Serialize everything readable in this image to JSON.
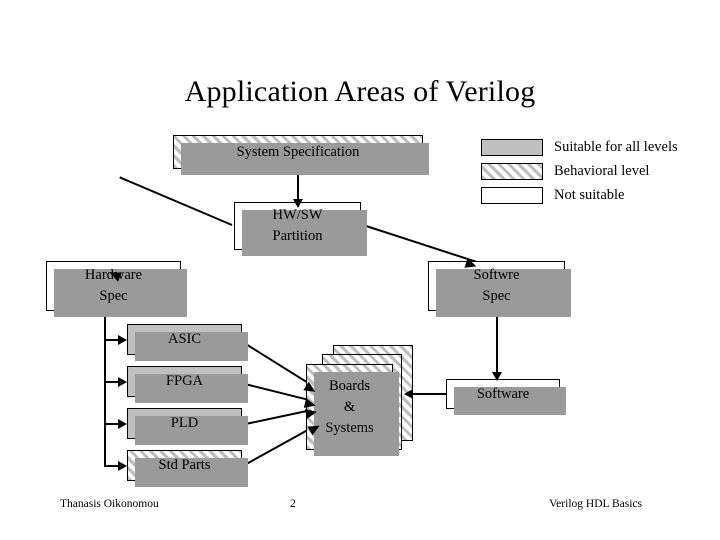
{
  "slide": {
    "title": "Application Areas of Verilog",
    "page_number": "2"
  },
  "legend": {
    "items": [
      {
        "swatch": "solid-gray-swatch",
        "label": "Suitable for all levels",
        "color": "#c0c0c0"
      },
      {
        "swatch": "hatched-swatch",
        "label": "Behavioral level",
        "color": "#bdbdbd"
      },
      {
        "swatch": "white-swatch",
        "label": "Not suitable",
        "color": "#ffffff"
      }
    ]
  },
  "diagram": {
    "nodes": {
      "system_specification": {
        "label": "System Specification",
        "fill": "Behavioral level"
      },
      "hw_sw_partition": {
        "line1": "HW/SW",
        "line2": "Partition",
        "fill": "Not suitable"
      },
      "hardware_spec": {
        "line1": "Hardware",
        "line2": "Spec",
        "fill": "Not suitable"
      },
      "software_spec": {
        "line1": "Softwre",
        "line2": "Spec",
        "fill": "Not suitable"
      },
      "asic": {
        "label": "ASIC",
        "fill": "Suitable for all levels"
      },
      "fpga": {
        "label": "FPGA",
        "fill": "Suitable for all levels"
      },
      "pld": {
        "label": "PLD",
        "fill": "Suitable for all levels"
      },
      "std_parts": {
        "label": "Std Parts",
        "fill": "Behavioral level"
      },
      "boards_systems": {
        "line1": "Boards",
        "line2": "&",
        "line3": "Systems",
        "fill": "Behavioral level"
      },
      "software": {
        "label": "Software",
        "fill": "Not suitable"
      }
    }
  },
  "footer": {
    "author": "Thanasis Oikonomou",
    "page": "2",
    "topic": "Verilog HDL Basics"
  }
}
